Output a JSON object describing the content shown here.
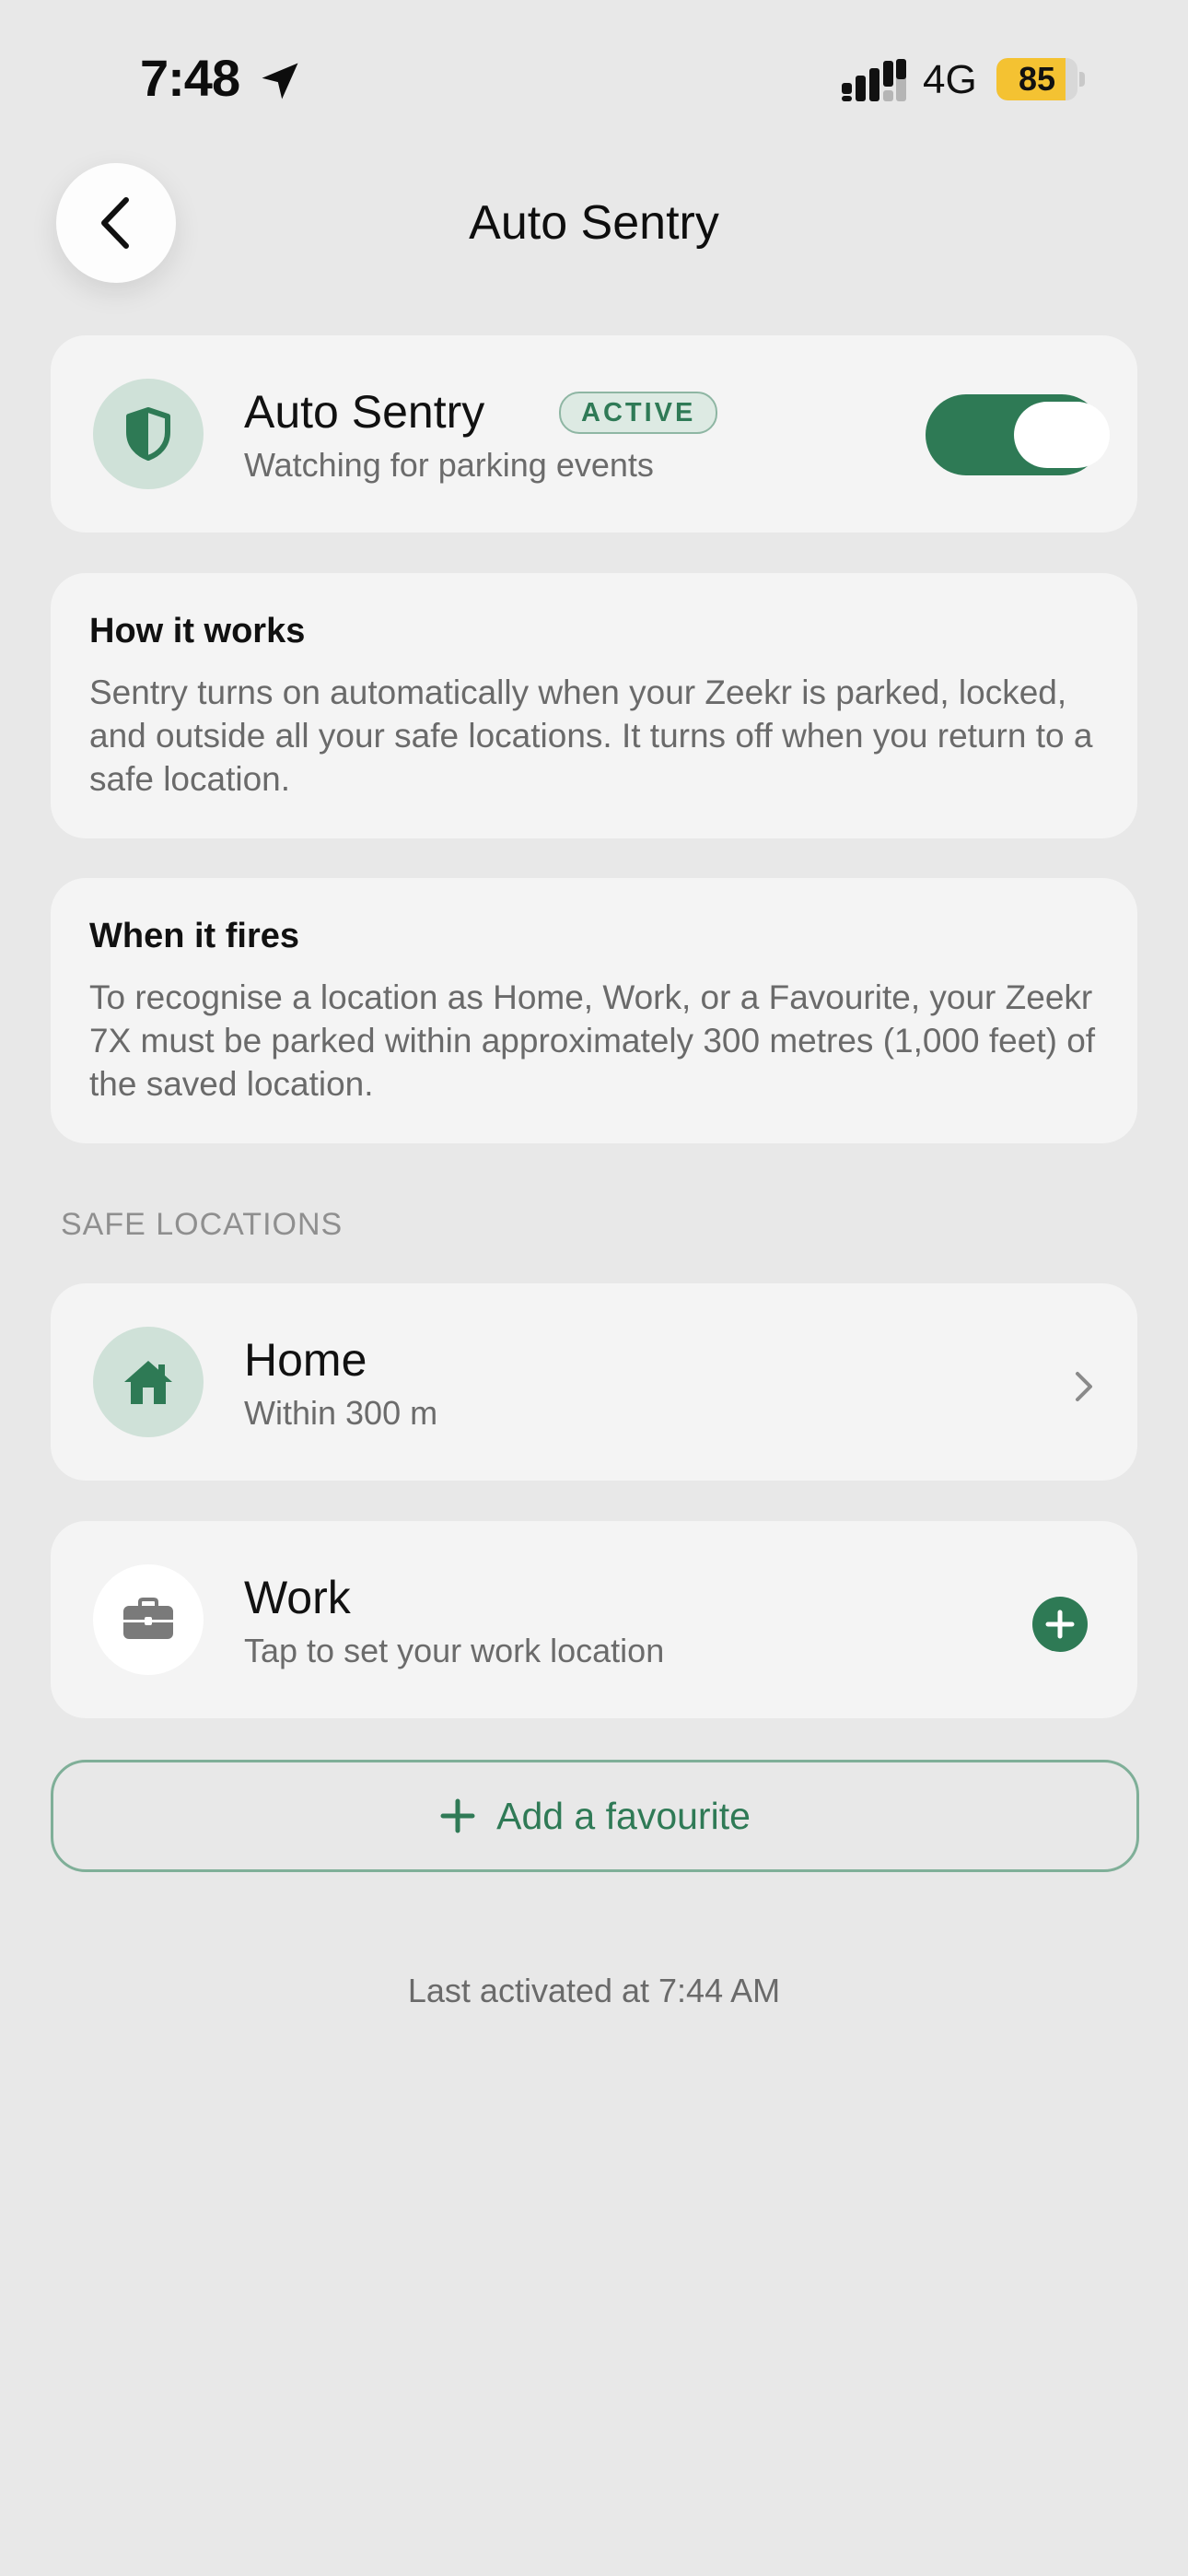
{
  "status_bar": {
    "time": "7:48",
    "network": "4G",
    "battery": "85",
    "battery_level": 0.85
  },
  "header": {
    "title": "Auto Sentry"
  },
  "sentry_card": {
    "title": "Auto Sentry",
    "badge": "ACTIVE",
    "subtitle": "Watching for parking events",
    "toggle_on": true
  },
  "how_it_works": {
    "title": "How it works",
    "body": "Sentry turns on automatically when your Zeekr is parked, locked, and outside all your safe locations. It turns off when you return to a safe location."
  },
  "when_it_fires": {
    "title": "When it fires",
    "body": "To recognise a location as Home, Work, or a Favourite, your Zeekr 7X must be parked within approximately 300 metres (1,000 feet) of the saved location."
  },
  "safe_locations": {
    "label": "SAFE LOCATIONS",
    "items": [
      {
        "title": "Home",
        "subtitle": "Within 300 m",
        "icon": "home-icon",
        "action_icon": "chevron-right-icon"
      },
      {
        "title": "Work",
        "subtitle": "Tap to set your work location",
        "icon": "briefcase-icon",
        "action_icon": "plus-circle-icon"
      }
    ]
  },
  "add_favourite": {
    "label": "Add a favourite"
  },
  "footer": {
    "last_activated": "Last activated at 7:44 AM"
  },
  "colors": {
    "accent": "#2E7A55",
    "background": "#E8E8E8",
    "card": "#F4F4F4",
    "battery": "#F4C232"
  }
}
